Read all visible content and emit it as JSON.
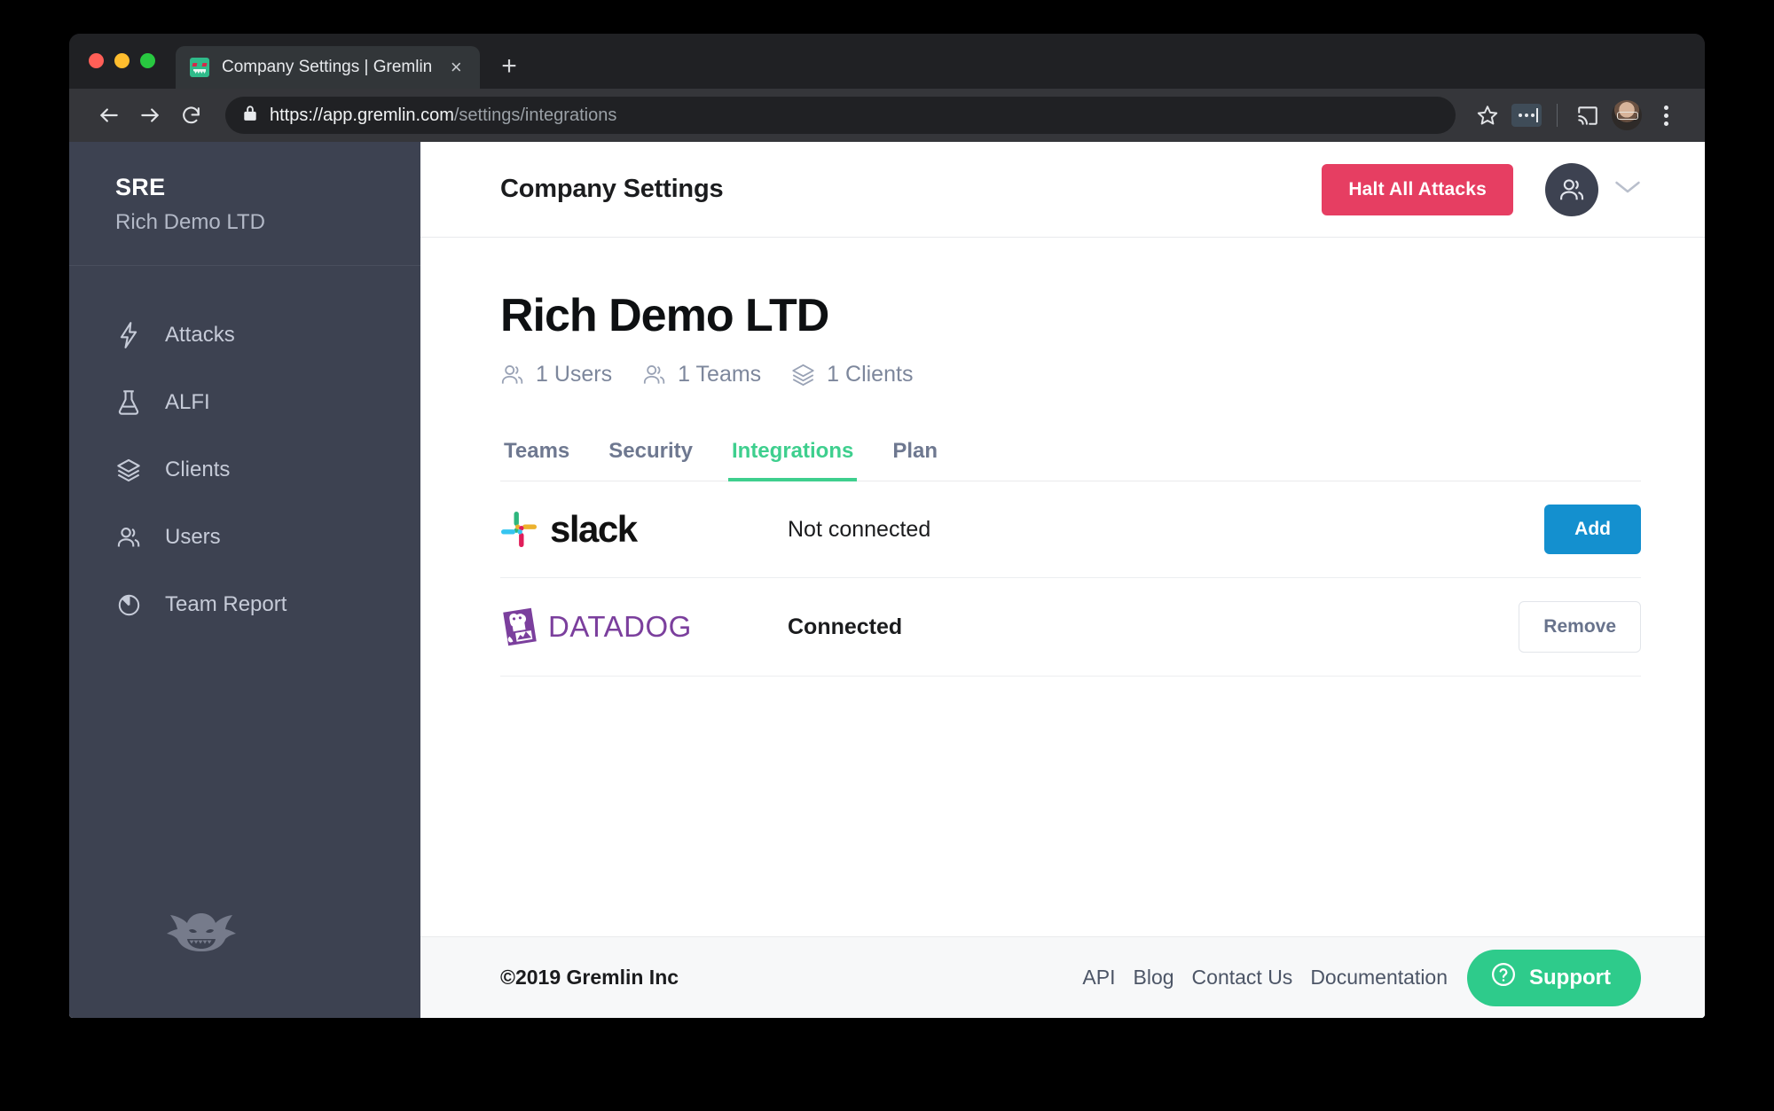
{
  "browser": {
    "tab": {
      "title": "Company Settings | Gremlin",
      "favicon": "gremlin-favicon",
      "close": "×"
    },
    "new_tab_label": "+",
    "address": {
      "secure_host": "https://app.gremlin.com",
      "path": "/settings/integrations"
    },
    "icons": {
      "back": "back-arrow-icon",
      "forward": "forward-arrow-icon",
      "reload": "reload-icon",
      "lock": "lock-icon",
      "bookmark": "star-icon",
      "extension": "extension-badge-icon",
      "cast": "cast-icon",
      "profile": "profile-avatar",
      "menu": "kebab-menu-icon"
    }
  },
  "sidebar": {
    "brand_title": "SRE",
    "brand_subtitle": "Rich Demo LTD",
    "items": [
      {
        "label": "Attacks",
        "icon": "lightning-bolt-icon"
      },
      {
        "label": "ALFI",
        "icon": "flask-icon"
      },
      {
        "label": "Clients",
        "icon": "layers-icon"
      },
      {
        "label": "Users",
        "icon": "users-icon"
      },
      {
        "label": "Team Report",
        "icon": "pie-chart-icon"
      }
    ],
    "logo": "gremlin-mascot-logo"
  },
  "topbar": {
    "title": "Company Settings",
    "halt_button": "Halt All Attacks",
    "user_menu_icon": "users-icon",
    "chevron_icon": "chevron-down-icon"
  },
  "page": {
    "title": "Rich Demo LTD",
    "stats": [
      {
        "label": "1 Users",
        "icon": "users-icon"
      },
      {
        "label": "1 Teams",
        "icon": "users-icon"
      },
      {
        "label": "1 Clients",
        "icon": "layers-icon"
      }
    ],
    "tabs": [
      {
        "label": "Teams",
        "active": false
      },
      {
        "label": "Security",
        "active": false
      },
      {
        "label": "Integrations",
        "active": true
      },
      {
        "label": "Plan",
        "active": false
      }
    ],
    "integrations": [
      {
        "name": "slack",
        "status": "Not connected",
        "action": "Add",
        "action_type": "primary"
      },
      {
        "name": "DATADOG",
        "status": "Connected",
        "action": "Remove",
        "action_type": "secondary"
      }
    ]
  },
  "footer": {
    "copyright": "©2019 Gremlin Inc",
    "links": [
      "API",
      "Blog",
      "Contact Us",
      "Documentation"
    ],
    "support_label": "Support",
    "support_icon": "question-circle-icon"
  },
  "colors": {
    "accent_green": "#3ecf8e",
    "danger_pink": "#e63e62",
    "primary_blue": "#1490cf",
    "support_green": "#2ecb8b",
    "sidebar_bg": "#3d4251",
    "datadog_purple": "#7b3f9d"
  }
}
